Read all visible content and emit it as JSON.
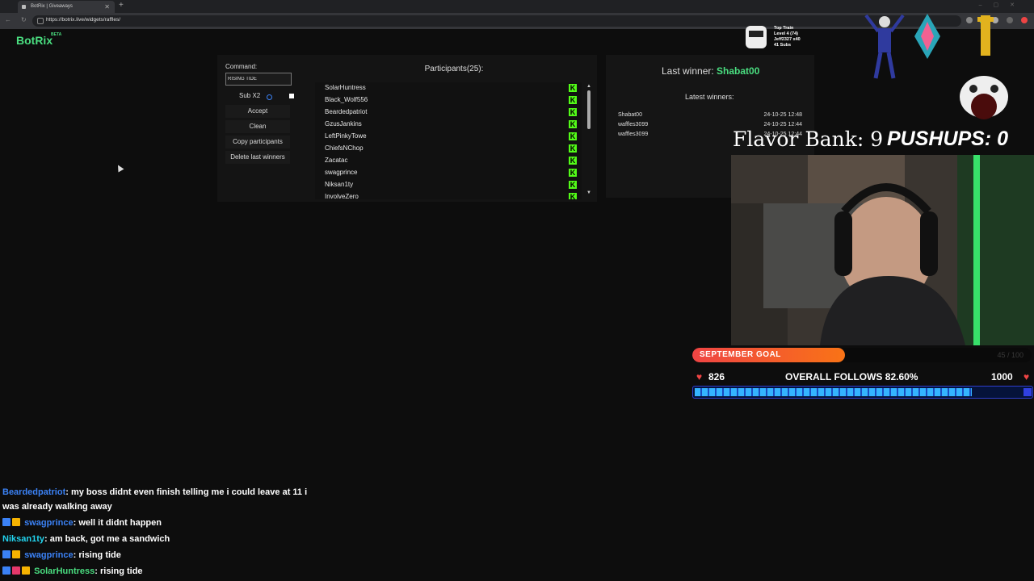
{
  "browser": {
    "tab_title": "BotRix | Giveaways",
    "url": "https://botrix.live/widgets/raffles/"
  },
  "app": {
    "logo": "BotRix",
    "beta": "BETA"
  },
  "raffle": {
    "command_label": "Command:",
    "command_value": "RISING TIDE",
    "sub_label": "Sub X2",
    "buttons": [
      "Accept",
      "Clean",
      "Copy participants",
      "Delete last winners"
    ],
    "participants_title": "Participants(25):",
    "participants": [
      "SolarHuntress",
      "Black_Wolf556",
      "Beardedpatriot",
      "GzusJankins",
      "LeftPinkyTowe",
      "ChiefsNChop",
      "Zacatac",
      "swagprince",
      "Niksan1ty",
      "InvolveZero"
    ],
    "kick_glyph": "K"
  },
  "winners": {
    "last_label": "Last winner:",
    "last_name": "Shabat00",
    "latest_title": "Latest winners:",
    "list": [
      {
        "name": "Shabat00",
        "date": "24-10-25 12:48"
      },
      {
        "name": "waffles3099",
        "date": "24-10-25 12:44"
      },
      {
        "name": "waffles3099",
        "date": "24-10-25 12:44"
      }
    ]
  },
  "overlay": {
    "train_lines": [
      "Top Train",
      "Level 4 (74)",
      "Jeff2327 x40",
      "41 Subs"
    ],
    "flavor_bank": "Flavor Bank: 9",
    "pushups": "PUSHUPS: 0",
    "goal_label": "SEPTEMBER GOAL",
    "goal_count": "45 / 100",
    "goal_fraction": 0.45,
    "follows_start": "826",
    "follows_label": "OVERALL FOLLOWS 82.60%",
    "follows_end": "1000",
    "follows_fraction": 0.826
  },
  "chat": [
    {
      "user": "Beardedpatriot",
      "text": ": my boss didnt even finish telling me i could leave at 11 i",
      "cls": "u1"
    },
    {
      "user": "",
      "text": "was already walking away",
      "cls": "u1"
    },
    {
      "user": "swagprince",
      "text": ": well it didnt happen",
      "cls": "u1"
    },
    {
      "user": "Niksan1ty",
      "text": ": am back, got me a sandwich",
      "cls": "u2"
    },
    {
      "user": "swagprince",
      "text": ": rising tide",
      "cls": "u1"
    },
    {
      "user": "SolarHuntress",
      "text": ": rising tide",
      "cls": "u3"
    }
  ],
  "colors": {
    "accent": "#4ade80",
    "kick": "#53fc18",
    "goal": "#f97316",
    "follows": "#34b4ff"
  }
}
